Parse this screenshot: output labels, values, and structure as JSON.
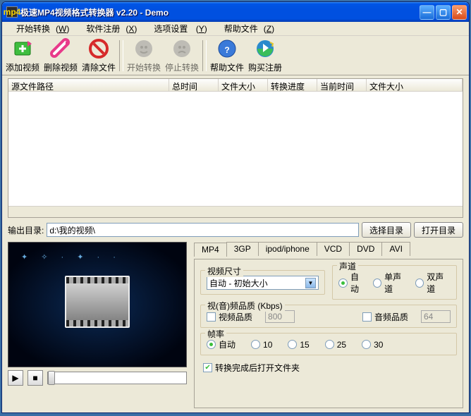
{
  "window": {
    "title": "极速MP4视频格式转换器  v2.20 - Demo",
    "icon_text": "mp4"
  },
  "menu": {
    "start": "开始转换",
    "start_k": "W",
    "register": "软件注册",
    "register_k": "X",
    "options": "选项设置",
    "options_k": "Y",
    "help": "帮助文件",
    "help_k": "Z"
  },
  "toolbar": {
    "add": "添加视频",
    "del": "删除视频",
    "clear": "清除文件",
    "start": "开始转换",
    "stop": "停止转换",
    "help": "帮助文件",
    "buy": "购买注册"
  },
  "columns": {
    "path": "源文件路径",
    "total": "总时间",
    "size1": "文件大小",
    "progress": "转换进度",
    "current": "当前时间",
    "size2": "文件大小"
  },
  "output": {
    "label": "输出目录:",
    "path": "d:\\我的视频\\",
    "choose": "选择目录",
    "open": "打开目录"
  },
  "tabs": {
    "mp4": "MP4",
    "tgp": "3GP",
    "ipod": "ipod/iphone",
    "vcd": "VCD",
    "dvd": "DVD",
    "avi": "AVI"
  },
  "settings": {
    "video_size": "视频尺寸",
    "size_value": "自动 - 初始大小",
    "sound": "声道",
    "auto": "自动",
    "mono": "单声道",
    "stereo": "双声道",
    "quality": "视(音)频品质 (Kbps)",
    "video_q": "视频品质",
    "video_q_val": "800",
    "audio_q": "音频品质",
    "audio_q_val": "64",
    "fps": "帧率",
    "fps10": "10",
    "fps15": "15",
    "fps25": "25",
    "fps30": "30"
  },
  "after": "转换完成后打开文件夹"
}
